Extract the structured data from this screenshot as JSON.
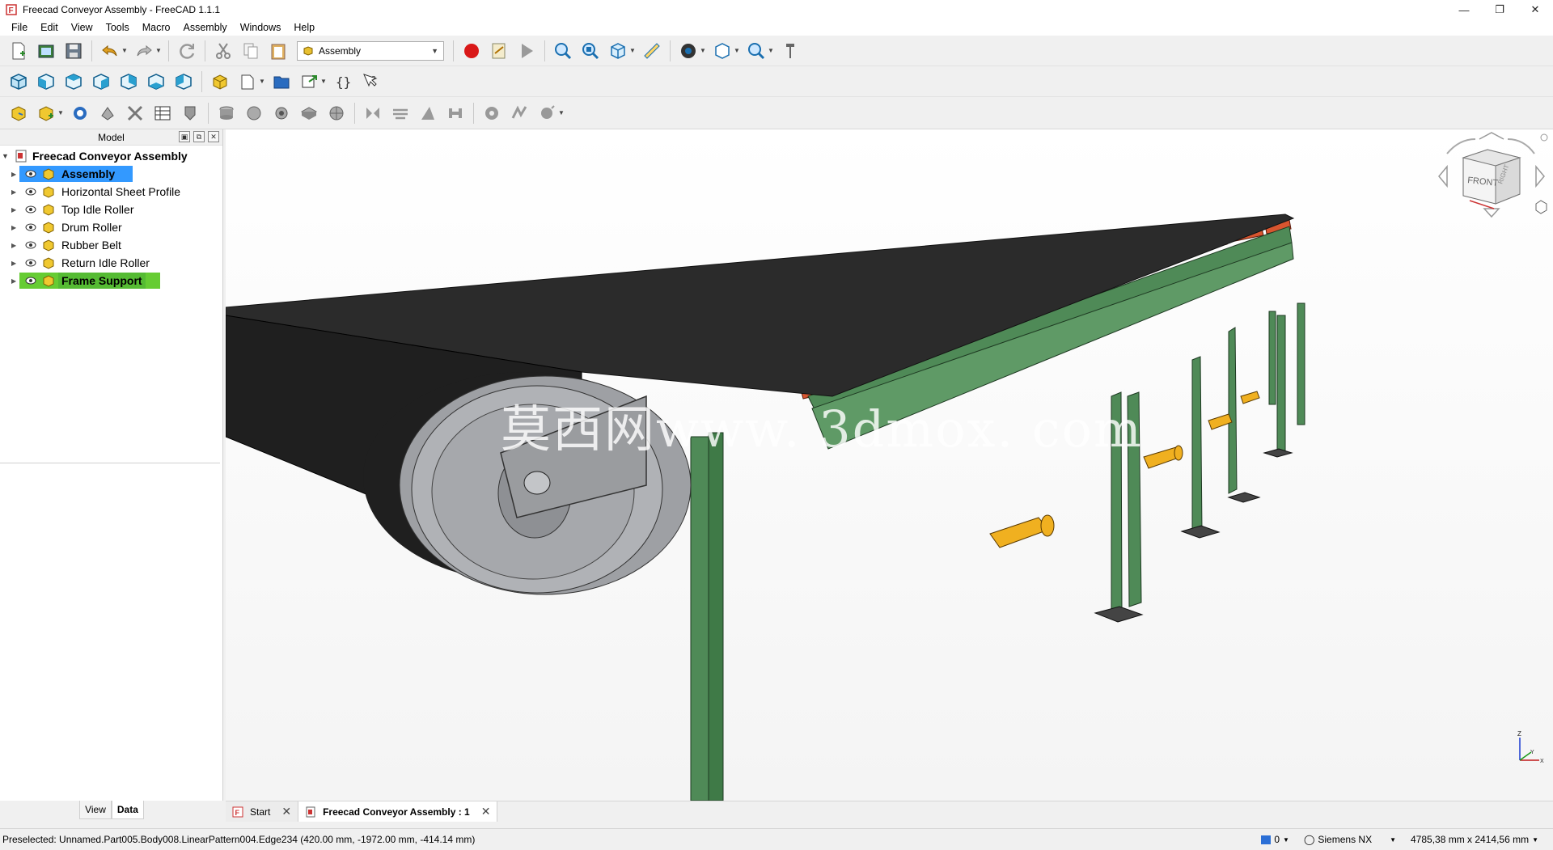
{
  "window": {
    "title": "Freecad Conveyor Assembly - FreeCAD 1.1.1",
    "controls": [
      "minimize",
      "restore",
      "close"
    ]
  },
  "menu": {
    "items": [
      {
        "label": "File"
      },
      {
        "label": "Edit"
      },
      {
        "label": "View"
      },
      {
        "label": "Tools"
      },
      {
        "label": "Macro"
      },
      {
        "label": "Assembly"
      },
      {
        "label": "Windows"
      },
      {
        "label": "Help"
      }
    ]
  },
  "toolbar": {
    "workbench": "Assembly",
    "row1_icons": [
      "new-document-icon",
      "open-icon",
      "save-icon",
      "undo-icon",
      "redo-icon",
      "refresh-icon",
      "cut-icon",
      "copy-icon",
      "paste-icon",
      "workbench-selector",
      "macro-record-icon",
      "macro-edit-icon",
      "macro-run-icon",
      "fit-all-icon",
      "fit-selection-icon",
      "standard-views-icon",
      "measure-icon",
      "draw-style-icon",
      "std-view-box-icon",
      "zoom-icon",
      "whats-this-icon"
    ],
    "row2_icons": [
      "view-isometric-icon",
      "view-front-icon",
      "view-top-icon",
      "view-right-icon",
      "view-rear-icon",
      "view-bottom-icon",
      "view-left-icon",
      "part-icon",
      "sketch-icon",
      "group-icon",
      "link-icon",
      "variable-set-icon",
      "help-icon"
    ],
    "row3_icons": [
      "assembly-new-icon",
      "insert-component-icon",
      "solve-icon",
      "joint-fixed-icon",
      "explode-icon",
      "bom-icon",
      "ground-icon",
      "joint-revolute-icon",
      "joint-cylindrical-icon",
      "joint-slider-icon",
      "joint-ball-icon",
      "joint-distance-icon",
      "joint-parallel-icon",
      "joint-perpendicular-icon",
      "joint-angle-icon",
      "gears-icon",
      "belt-icon",
      "simulation-icon"
    ]
  },
  "model_panel": {
    "title": "Model",
    "root": "Freecad Conveyor Assembly",
    "items": [
      {
        "label": "Assembly",
        "state": "selected"
      },
      {
        "label": "Horizontal Sheet Profile",
        "state": "normal"
      },
      {
        "label": "Top Idle Roller",
        "state": "normal"
      },
      {
        "label": "Drum Roller",
        "state": "normal"
      },
      {
        "label": "Rubber Belt",
        "state": "normal"
      },
      {
        "label": "Return Idle Roller",
        "state": "normal"
      },
      {
        "label": "Frame Support",
        "state": "highlighted"
      }
    ],
    "tabs": [
      "View",
      "Data"
    ],
    "active_tab": "Data"
  },
  "view3d": {
    "watermark": "莫西网www. 3dmox. com",
    "navcube_faces": [
      "FRONT",
      "RIGHT"
    ]
  },
  "doc_tabs": [
    {
      "label": "Start",
      "active": false
    },
    {
      "label": "Freecad Conveyor Assembly : 1",
      "active": true
    }
  ],
  "status": {
    "preselected": "Preselected: Unnamed.Part005.Body008.LinearPattern004.Edge234 (420.00 mm, -1972.00 mm, -414.14 mm)",
    "notifications": "0",
    "navigation_style": "Siemens NX",
    "dimensions": "4785,38 mm x 2414,56 mm"
  },
  "colors": {
    "selection": "#3399ff",
    "preselection": "#66cc33",
    "belt": "#2b2b2b",
    "roller_top": "#d8552f",
    "roller_return": "#f0b020",
    "frame": "#4f8a57",
    "drum": "#b0b2b6"
  }
}
